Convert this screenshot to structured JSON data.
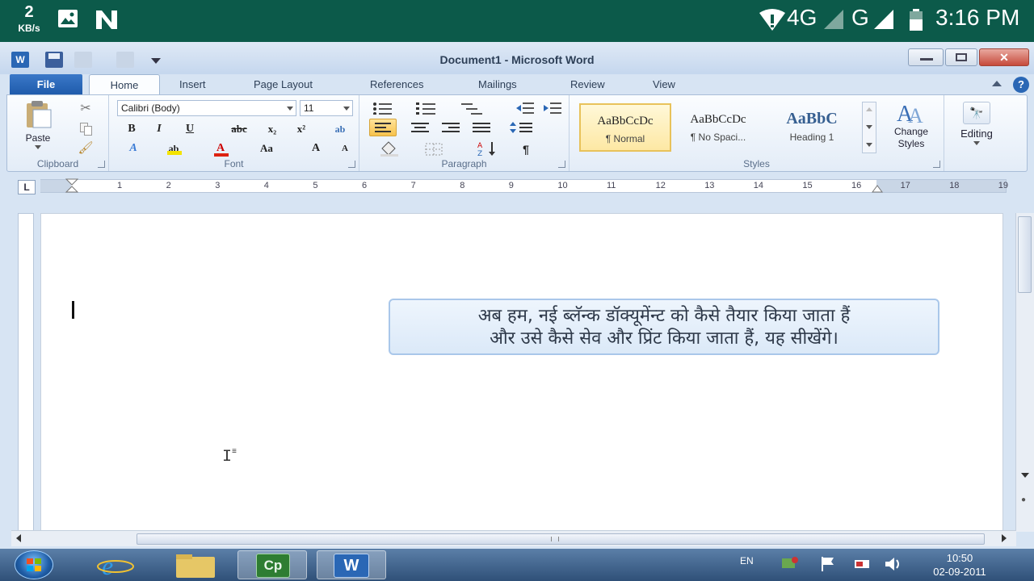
{
  "status_bar": {
    "speed_value": "2",
    "speed_unit": "KB/s",
    "network_4g": "4G",
    "network_g": "G",
    "time": "3:16 PM",
    "icons": [
      "image-icon",
      "n-app-icon",
      "wifi-icon",
      "signal-icon",
      "battery-icon"
    ]
  },
  "window": {
    "title": "Document1 - Microsoft Word",
    "tabs": [
      "File",
      "Home",
      "Insert",
      "Page Layout",
      "References",
      "Mailings",
      "Review",
      "View"
    ],
    "font_name": "Calibri (Body)",
    "font_size": "11",
    "clipboard": {
      "paste": "Paste",
      "label": "Clipboard"
    },
    "font_group_label": "Font",
    "paragraph_group_label": "Paragraph",
    "styles_group_label": "Styles",
    "styles": [
      {
        "sample": "AaBbCcDc",
        "name": "¶ Normal"
      },
      {
        "sample": "AaBbCcDc",
        "name": "¶ No Spaci..."
      },
      {
        "sample": "AaBbC\u0010",
        "name": "Heading 1"
      }
    ],
    "change_styles": "Change Styles",
    "editing": "Editing",
    "ruler_numbers": [
      "1",
      "2",
      "3",
      "4",
      "5",
      "6",
      "7",
      "8",
      "9",
      "10",
      "11",
      "12",
      "13",
      "14",
      "15",
      "16",
      "17",
      "18",
      "19"
    ],
    "tab_selector": "L"
  },
  "document": {
    "callout_line1": "अब हम, नई ब्लॅन्क डॉक्यूमेंन्ट को कैसे तैयार किया जाता हैं",
    "callout_line2": "और उसे कैसे सेव और प्रिंट किया जाता हैं, यह सीखेंगे।"
  },
  "taskbar": {
    "apps": [
      "start-orb",
      "internet-explorer",
      "file-explorer",
      "captivate",
      "word"
    ],
    "captivate_label": "Cp",
    "word_label": "W",
    "language": "EN",
    "time": "10:50",
    "date": "02-09-2011"
  },
  "colors": {
    "status_bar": "#0c5a4a",
    "ribbon": "#e3ecf7",
    "file_tab": "#1f5bab",
    "taskbar": "#2f5078"
  }
}
